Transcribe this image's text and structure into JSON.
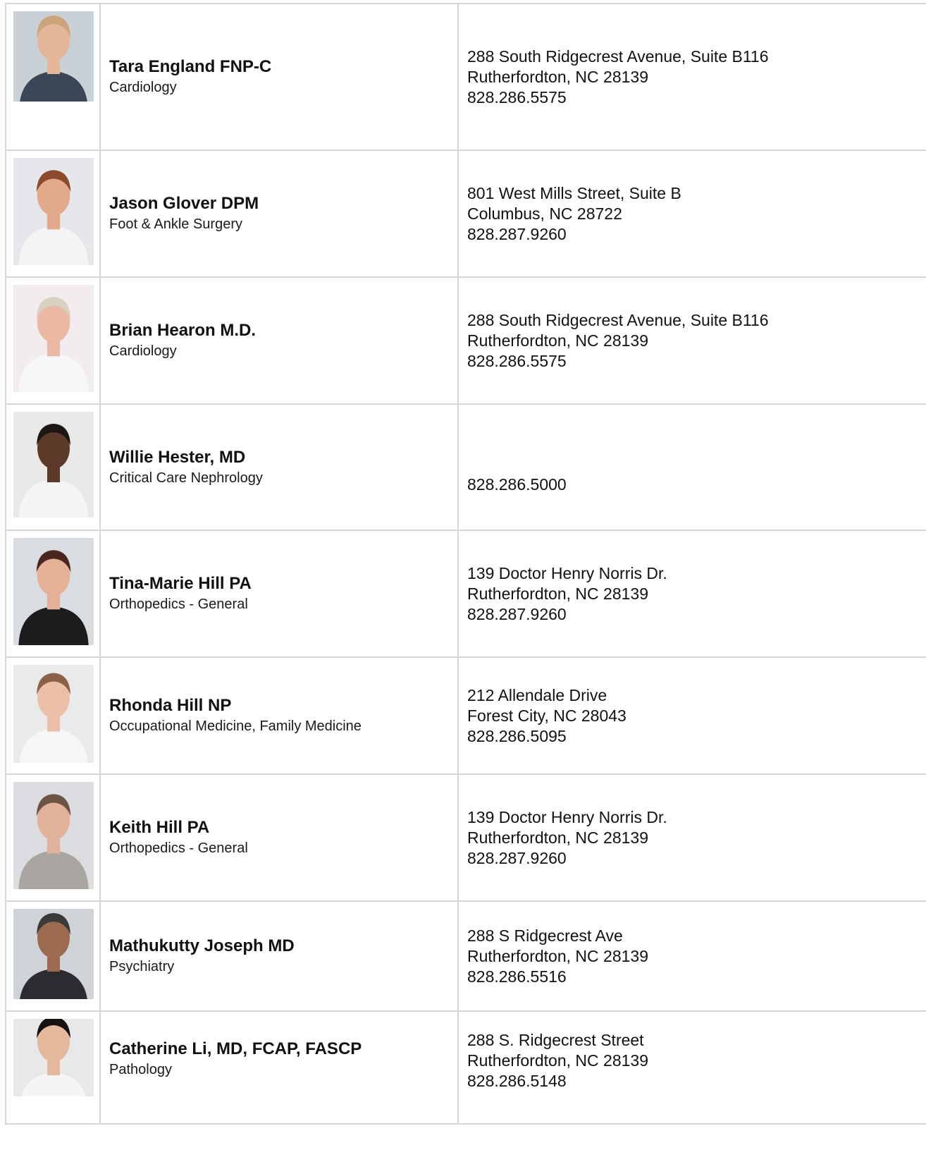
{
  "providers": [
    {
      "name": "Tara England FNP-C",
      "specialty": "Cardiology",
      "address_line1": "288 South Ridgecrest Avenue, Suite B116",
      "address_line2": "Rutherfordton, NC 28139",
      "phone": "828.286.5575",
      "photo": {
        "bg": "#c9d0d6",
        "hair": "#caa57a",
        "skin": "#e5b79a",
        "clothing": "#3b4656"
      }
    },
    {
      "name": "Jason Glover DPM",
      "specialty": "Foot & Ankle Surgery",
      "address_line1": "801 West Mills Street, Suite B",
      "address_line2": "Columbus, NC 28722",
      "phone": "828.287.9260",
      "photo": {
        "bg": "#e6e7ea",
        "hair": "#8a4a2b",
        "skin": "#e2a98a",
        "clothing": "#f4f4f4"
      }
    },
    {
      "name": "Brian Hearon M.D.",
      "specialty": "Cardiology",
      "address_line1": "288 South Ridgecrest Avenue, Suite B116",
      "address_line2": "Rutherfordton, NC 28139",
      "phone": "828.286.5575",
      "photo": {
        "bg": "#f3ecef",
        "hair": "#d9d0c2",
        "skin": "#eab8a3",
        "clothing": "#f7f7f7"
      }
    },
    {
      "name": "Willie Hester, MD",
      "specialty": "Critical Care Nephrology",
      "address_line1": "",
      "address_line2": "",
      "phone": "828.286.5000",
      "photo": {
        "bg": "#e9e9e7",
        "hair": "#1d1714",
        "skin": "#5b3a29",
        "clothing": "#f5f5f5"
      }
    },
    {
      "name": "Tina-Marie Hill PA",
      "specialty": "Orthopedics - General",
      "address_line1": "139 Doctor Henry Norris Dr.",
      "address_line2": "Rutherfordton, NC 28139",
      "phone": "828.287.9260",
      "photo": {
        "bg": "#d9dde2",
        "hair": "#4a2620",
        "skin": "#e4b096",
        "clothing": "#1c1c1c"
      }
    },
    {
      "name": "Rhonda Hill NP",
      "specialty": "Occupational Medicine, Family Medicine",
      "address_line1": "212 Allendale Drive",
      "address_line2": "Forest City, NC 28043",
      "phone": "828.286.5095",
      "photo": {
        "bg": "#e9eaec",
        "hair": "#8a6148",
        "skin": "#ecc0a8",
        "clothing": "#f6f6f6"
      }
    },
    {
      "name": "Keith Hill PA",
      "specialty": "Orthopedics - General",
      "address_line1": "139 Doctor Henry Norris Dr.",
      "address_line2": "Rutherfordton, NC 28139",
      "phone": "828.287.9260",
      "photo": {
        "bg": "#dcdde0",
        "hair": "#6b5444",
        "skin": "#e1b19a",
        "clothing": "#a9a5a0"
      }
    },
    {
      "name": "Mathukutty Joseph MD",
      "specialty": "Psychiatry",
      "address_line1": "288 S Ridgecrest Ave",
      "address_line2": "Rutherfordton, NC 28139",
      "phone": "828.286.5516",
      "photo": {
        "bg": "#cfd2d6",
        "hair": "#3a3a3a",
        "skin": "#9c6a4e",
        "clothing": "#2b2b30"
      }
    },
    {
      "name": "Catherine Li, MD, FCAP, FASCP",
      "specialty": "Pathology",
      "address_line1": "288 S. Ridgecrest Street",
      "address_line2": "Rutherfordton, NC 28139",
      "phone": "828.286.5148",
      "photo": {
        "bg": "#e7e8ea",
        "hair": "#151212",
        "skin": "#e4b99b",
        "clothing": "#f5f5f5"
      }
    }
  ]
}
